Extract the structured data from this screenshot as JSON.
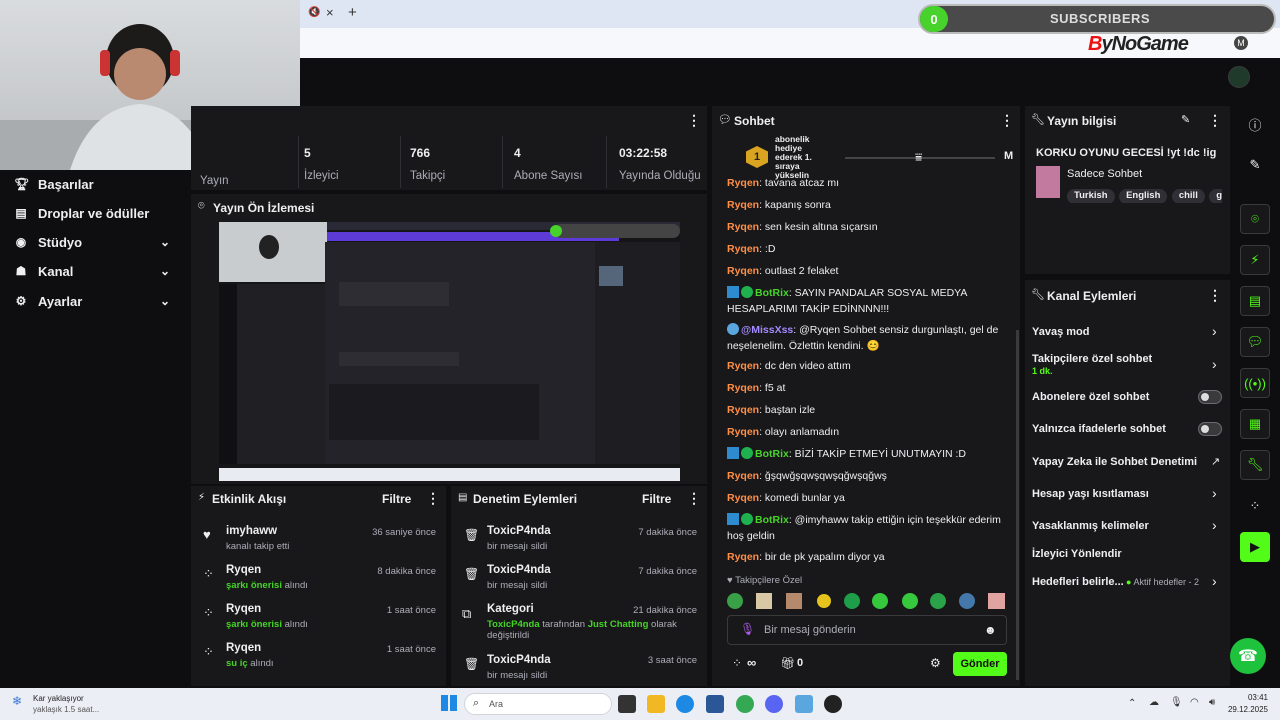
{
  "browser": {
    "new_tab": "+",
    "tab_mute": "🔇",
    "tab_close": "×",
    "win_min": "—",
    "win_max": "▢",
    "win_close": "✕",
    "profile": "M"
  },
  "overlay": {
    "subscriber_count": "0",
    "subscriber_label": "SUBSCRIBERS",
    "brand_by": "B",
    "brand_rest": "yNoGame"
  },
  "sidebar": {
    "items": [
      {
        "label": "Başarılar",
        "icon": "trophy-icon"
      },
      {
        "label": "Droplar ve ödüller",
        "icon": "gift-icon"
      },
      {
        "label": "Stüdyo",
        "icon": "studio-icon"
      },
      {
        "label": "Kanal",
        "icon": "channel-icon"
      },
      {
        "label": "Ayarlar",
        "icon": "gear-icon"
      }
    ]
  },
  "stats": {
    "live_label": "Yayın",
    "viewers_value": "5",
    "viewers_label": "İzleyici",
    "followers_value": "766",
    "followers_label": "Takipçi",
    "subs_value": "4",
    "subs_label": "Abone Sayısı",
    "uptime_value": "03:22:58",
    "uptime_label": "Yayında Olduğu"
  },
  "preview": {
    "title": "Yayın Ön İzlemesi"
  },
  "activity": {
    "title": "Etkinlik Akışı",
    "filter": "Filtre",
    "items": [
      {
        "name": "imyhaww",
        "desc": "kanalı takip etti",
        "time": "36 saniye önce",
        "hl": "",
        "rest": ""
      },
      {
        "name": "Ryqen",
        "desc": "",
        "time": "8 dakika önce",
        "hl": "şarkı önerisi",
        "rest": " alındı"
      },
      {
        "name": "Ryqen",
        "desc": "",
        "time": "1 saat önce",
        "hl": "şarkı önerisi",
        "rest": " alındı"
      },
      {
        "name": "Ryqen",
        "desc": "",
        "time": "1 saat önce",
        "hl": "su iç",
        "rest": " alındı"
      }
    ]
  },
  "moderation": {
    "title": "Denetim Eylemleri",
    "filter": "Filtre",
    "items": [
      {
        "name": "ToxicP4nda",
        "desc": "bir mesajı sildi",
        "time": "7 dakika önce"
      },
      {
        "name": "ToxicP4nda",
        "desc": "bir mesajı sildi",
        "time": "7 dakika önce"
      },
      {
        "name": "Kategori",
        "time": "21 dakika önce",
        "p1": "ToxicP4nda",
        "p2": " tarafından ",
        "p3": "Just Chatting",
        "p4": " olarak",
        "p5": "değiştirildi"
      },
      {
        "name": "ToxicP4nda",
        "desc": "bir mesajı sildi",
        "time": "3 saat önce"
      }
    ]
  },
  "chat": {
    "title": "Sohbet",
    "pinned_rank": "1",
    "pinned_text": "abonelik hediye ederek 1. sıraya yükselin",
    "pinned_user": "M",
    "lines": [
      {
        "user": "Ryqen",
        "text": ": tavana atcaz mı",
        "kind": "u"
      },
      {
        "user": "Ryqen",
        "text": ": kapanış sonra",
        "kind": "u"
      },
      {
        "user": "Ryqen",
        "text": ": sen kesin altına sıçarsın",
        "kind": "u"
      },
      {
        "user": "Ryqen",
        "text": ": :D",
        "kind": "u"
      },
      {
        "user": "Ryqen",
        "text": ": outlast 2 felaket",
        "kind": "u"
      },
      {
        "user": "BotRix",
        "text": ": SAYIN PANDALAR SOSYAL MEDYA HESAPLARIMI TAKİP EDİNNNN!!!",
        "kind": "b"
      },
      {
        "user": "@MissXss",
        "text": ": @Ryqen Sohbet sensiz durgunlaştı, gel de neşelenelim. Özlettin kendini. 😊",
        "kind": "m"
      },
      {
        "user": "Ryqen",
        "text": ": dc den video attım",
        "kind": "u"
      },
      {
        "user": "Ryqen",
        "text": ": f5 at",
        "kind": "u"
      },
      {
        "user": "Ryqen",
        "text": ": baştan izle",
        "kind": "u"
      },
      {
        "user": "Ryqen",
        "text": ": olayı anlamadın",
        "kind": "u"
      },
      {
        "user": "BotRix",
        "text": ": BİZİ TAKİP ETMEYİ UNUTMAYIN :D",
        "kind": "b"
      },
      {
        "user": "Ryqen",
        "text": ": ğşqwğşqwşqwşqğwşqğwş",
        "kind": "u"
      },
      {
        "user": "Ryqen",
        "text": ": komedi bunlar ya",
        "kind": "u"
      },
      {
        "user": "BotRix",
        "text": ": @imyhaww takip ettiğin için teşekkür ederim hoş geldin",
        "kind": "b"
      },
      {
        "user": "Ryqen",
        "text": ": bir de pk yapalım diyor ya",
        "kind": "u"
      }
    ],
    "followers_only": "Takipçilere Özel",
    "input_placeholder": "Bir mesaj gönderin",
    "points": "∞",
    "gift_count": "0",
    "send": "Gönder"
  },
  "stream_info": {
    "title": "Yayın bilgisi",
    "stream_title": "KORKU OYUNU GECESİ !yt !dc !ig",
    "category": "Sadece Sohbet",
    "tags": [
      "Turkish",
      "English",
      "chill",
      "gar"
    ]
  },
  "channel_actions": {
    "title": "Kanal Eylemleri",
    "slow_mode": "Yavaş mod",
    "followers_chat": "Takipçilere özel sohbet",
    "followers_chat_sub": "1 dk.",
    "subs_chat": "Abonelere özel sohbet",
    "emote_chat": "Yalnızca ifadelerle sohbet",
    "ai_mod": "Yapay Zeka ile Sohbet Denetimi",
    "age_limit": "Hesap yaşı kısıtlaması",
    "banned_words": "Yasaklanmış kelimeler",
    "raid": "İzleyici Yönlendir",
    "goals": "Hedefleri belirle...",
    "goals_status": "Aktif hedefler - 2"
  },
  "taskbar": {
    "weather_title": "Kar yaklaşıyor",
    "weather_sub": "yaklaşık 1.5 saat...",
    "search": "Ara",
    "time": "03:41",
    "date": "29.12.2025"
  }
}
